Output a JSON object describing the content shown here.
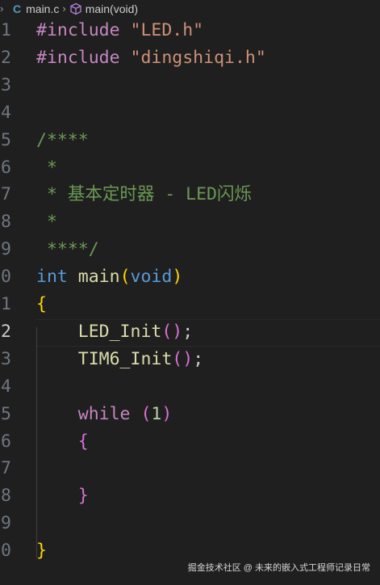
{
  "breadcrumb": {
    "file_icon": "C",
    "file": "main.c",
    "separator": "›",
    "symbol": "main(void)",
    "symbol_icon": "cube-icon"
  },
  "editor": {
    "lines": [
      {
        "num": "1",
        "tokens": [
          {
            "t": "#include",
            "k": "pre"
          },
          {
            "t": " ",
            "k": "p"
          },
          {
            "t": "\"LED.h\"",
            "k": "str"
          }
        ]
      },
      {
        "num": "2",
        "tokens": [
          {
            "t": "#include",
            "k": "pre"
          },
          {
            "t": " ",
            "k": "p"
          },
          {
            "t": "\"dingshiqi.h\"",
            "k": "str"
          }
        ]
      },
      {
        "num": "3",
        "tokens": []
      },
      {
        "num": "4",
        "tokens": []
      },
      {
        "num": "5",
        "tokens": [
          {
            "t": "/****",
            "k": "com"
          }
        ]
      },
      {
        "num": "6",
        "tokens": [
          {
            "t": " *",
            "k": "com"
          }
        ]
      },
      {
        "num": "7",
        "tokens": [
          {
            "t": " * 基本定时器 - LED闪烁",
            "k": "com"
          }
        ]
      },
      {
        "num": "8",
        "tokens": [
          {
            "t": " *",
            "k": "com"
          }
        ]
      },
      {
        "num": "9",
        "tokens": [
          {
            "t": " ****/",
            "k": "com"
          }
        ]
      },
      {
        "num": "0",
        "tokens": [
          {
            "t": "int",
            "k": "type"
          },
          {
            "t": " ",
            "k": "p"
          },
          {
            "t": "main",
            "k": "fn"
          },
          {
            "t": "(",
            "k": "b1"
          },
          {
            "t": "void",
            "k": "type"
          },
          {
            "t": ")",
            "k": "b1"
          }
        ]
      },
      {
        "num": "1",
        "tokens": [
          {
            "t": "{",
            "k": "b1"
          }
        ]
      },
      {
        "num": "2",
        "tokens": [
          {
            "t": "    ",
            "k": "p"
          },
          {
            "t": "LED_Init",
            "k": "fn"
          },
          {
            "t": "(",
            "k": "b2"
          },
          {
            "t": ")",
            "k": "b2"
          },
          {
            "t": ";",
            "k": "p"
          }
        ],
        "active": true
      },
      {
        "num": "3",
        "tokens": [
          {
            "t": "    ",
            "k": "p"
          },
          {
            "t": "TIM6_Init",
            "k": "fn"
          },
          {
            "t": "(",
            "k": "b2"
          },
          {
            "t": ")",
            "k": "b2"
          },
          {
            "t": ";",
            "k": "p"
          }
        ]
      },
      {
        "num": "4",
        "tokens": []
      },
      {
        "num": "5",
        "tokens": [
          {
            "t": "    ",
            "k": "p"
          },
          {
            "t": "while",
            "k": "ctl"
          },
          {
            "t": " ",
            "k": "p"
          },
          {
            "t": "(",
            "k": "b2"
          },
          {
            "t": "1",
            "k": "num"
          },
          {
            "t": ")",
            "k": "b2"
          }
        ]
      },
      {
        "num": "6",
        "tokens": [
          {
            "t": "    ",
            "k": "p"
          },
          {
            "t": "{",
            "k": "b2"
          }
        ]
      },
      {
        "num": "7",
        "tokens": []
      },
      {
        "num": "8",
        "tokens": [
          {
            "t": "    ",
            "k": "p"
          },
          {
            "t": "}",
            "k": "b2"
          }
        ]
      },
      {
        "num": "9",
        "tokens": []
      },
      {
        "num": "0",
        "tokens": [
          {
            "t": "}",
            "k": "b1"
          }
        ]
      }
    ]
  },
  "watermark": "掘金技术社区 @ 未来的嵌入式工程师记录日常",
  "colors": {
    "background": "#1f1f1f",
    "preprocessor": "#c586c0",
    "string": "#ce9178",
    "comment": "#6a9955",
    "type": "#569cd6",
    "function": "#dcdcaa",
    "bracket_level1": "#ffd700",
    "bracket_level2": "#da70d6",
    "number": "#b5cea8"
  }
}
